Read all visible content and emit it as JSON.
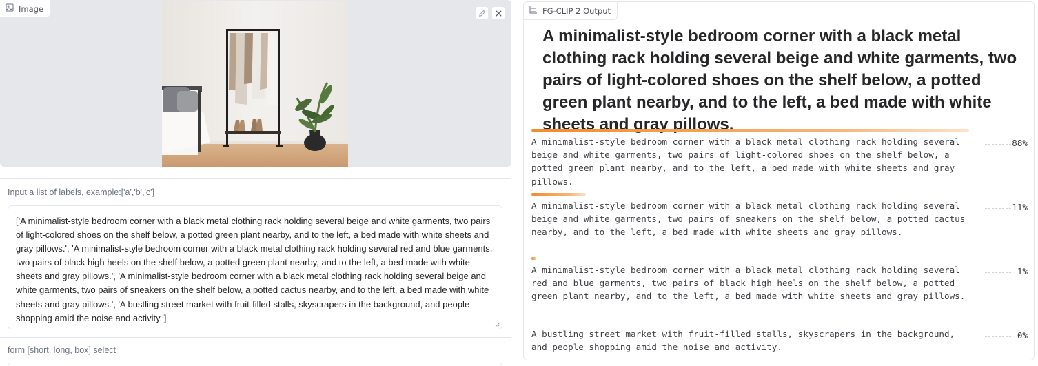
{
  "input": {
    "image_tag": "Image",
    "edit_icon": "pencil-icon",
    "clear_icon": "close-icon",
    "labels_field_label": "Input a list of labels, example:['a','b','c']",
    "labels_value": "['A minimalist-style bedroom corner with a black metal clothing rack holding several beige and white garments, two pairs of light-colored shoes on the shelf below, a potted green plant nearby, and to the left, a bed made with white sheets and gray pillows.', 'A minimalist-style bedroom corner with a black metal clothing rack holding several red and blue garments, two pairs of black high heels on the shelf below, a potted green plant nearby, and to the left, a bed made with white sheets and gray pillows.', 'A minimalist-style bedroom corner with a black metal clothing rack holding several beige and white garments, two pairs of sneakers on the shelf below, a potted cactus nearby, and to the left, a bed made with white sheets and gray pillows.', 'A bustling street market with fruit-filled stalls, skyscrapers in the background, and people shopping amid the noise and activity.']",
    "form_field_label": "form [short, long, box] select"
  },
  "output": {
    "tag": "FG-CLIP 2 Output",
    "top_label": "A minimalist-style bedroom corner with a black metal clothing rack holding several beige and white garments, two pairs of light-colored shoes on the shelf below, a potted green plant nearby, and to the left, a bed made with white sheets and gray pillows.",
    "confidences": [
      {
        "label": "A minimalist-style bedroom corner with a black metal clothing rack holding several beige and white garments, two pairs of light-colored shoes on the shelf below, a potted green plant nearby, and to the left, a bed made with white sheets and gray pillows.",
        "percent": "88%",
        "value": 0.88
      },
      {
        "label": "A minimalist-style bedroom corner with a black metal clothing rack holding several beige and white garments, two pairs of sneakers on the shelf below, a potted cactus nearby, and to the left, a bed made with white sheets and gray pillows.",
        "percent": "11%",
        "value": 0.11
      },
      {
        "label": "A minimalist-style bedroom corner with a black metal clothing rack holding several red and blue garments, two pairs of black high heels on the shelf below, a potted green plant nearby, and to the left, a bed made with white sheets and gray pillows.",
        "percent": "1%",
        "value": 0.01
      },
      {
        "label": "A bustling street market with fruit-filled stalls, skyscrapers in the background, and people shopping amid the noise and activity.",
        "percent": "0%",
        "value": 0.0
      }
    ]
  },
  "colors": {
    "accent": "#f58a2b",
    "panel_bg": "#e5e7eb",
    "border": "#e5e7eb"
  }
}
